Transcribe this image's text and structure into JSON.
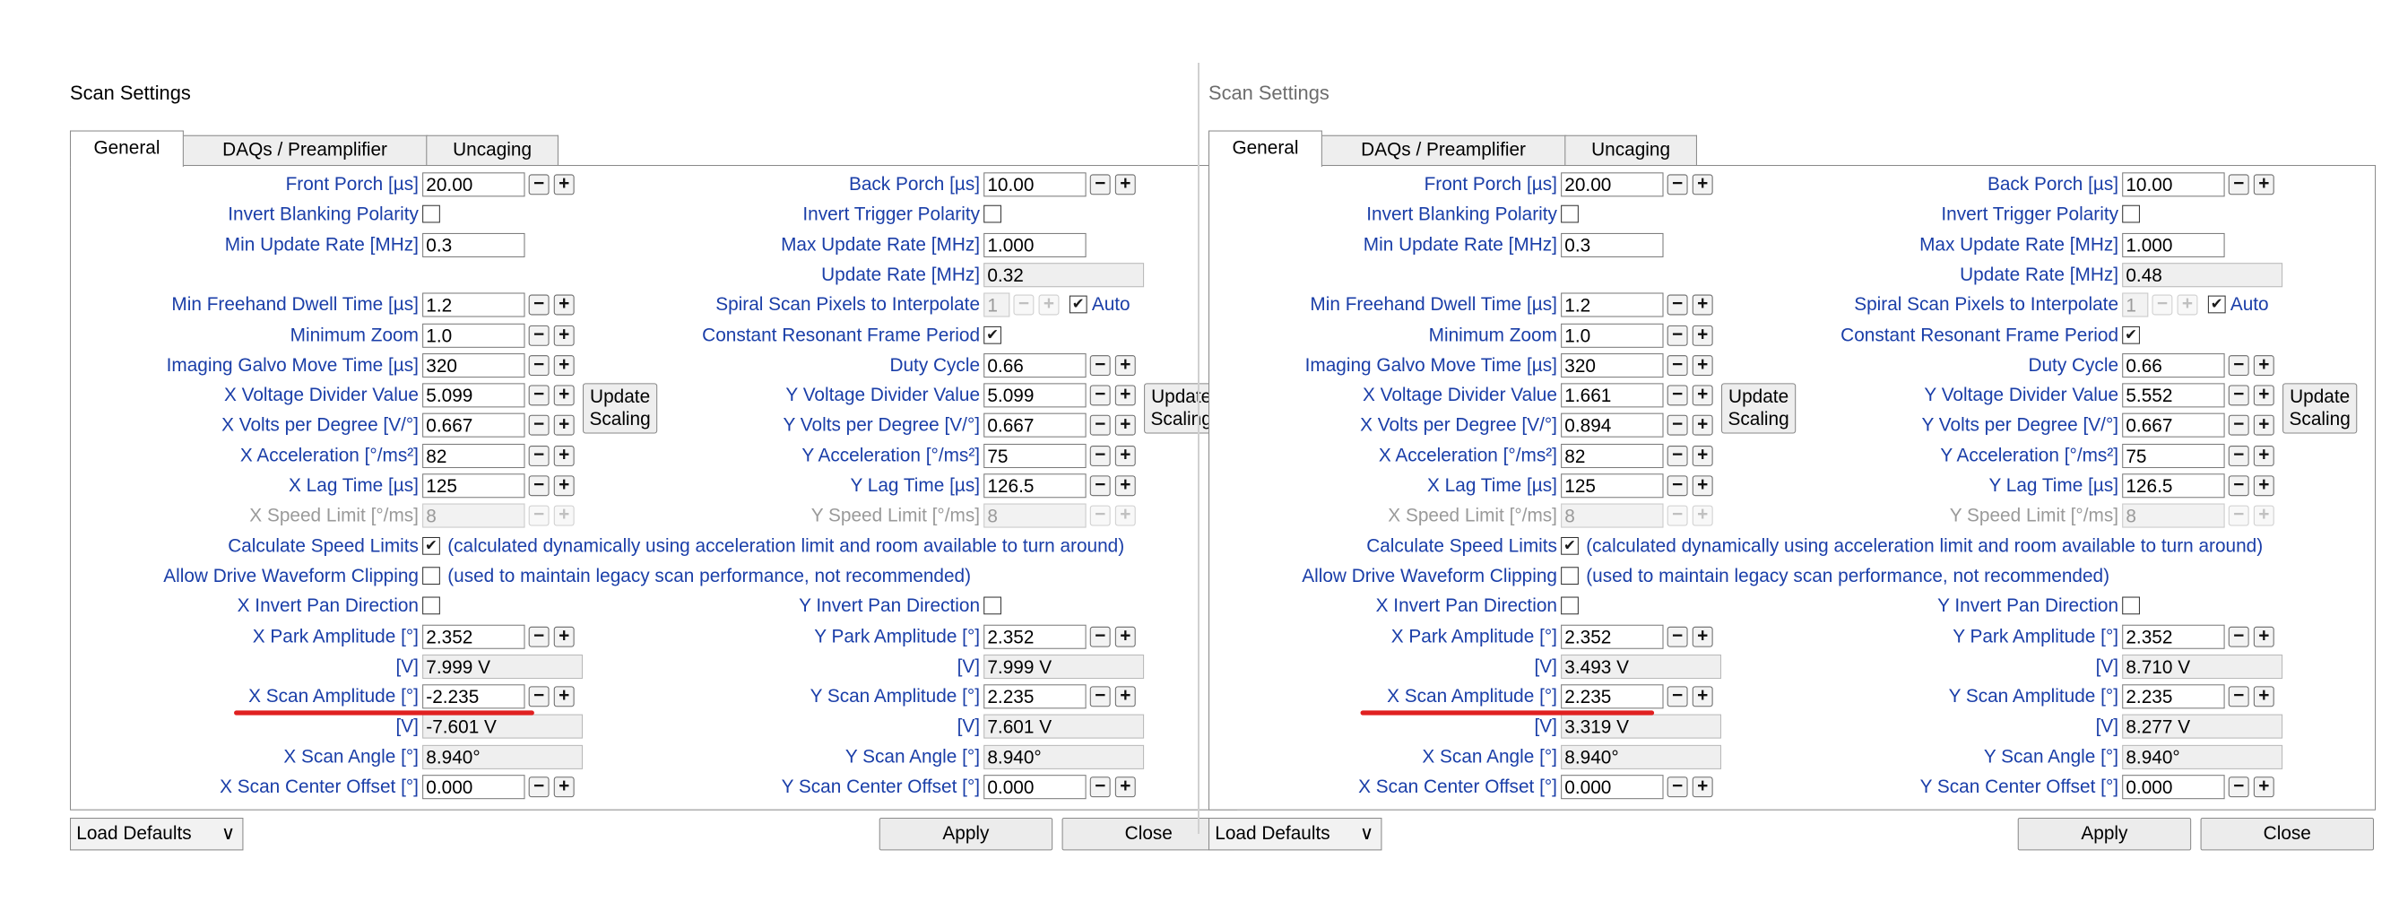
{
  "panels": [
    {
      "title": "Scan Settings",
      "title_dim": false,
      "tabs": [
        "General",
        "DAQs / Preamplifier",
        "Uncaging"
      ],
      "left": {
        "front_porch": {
          "label": "Front Porch [µs]",
          "value": "20.00"
        },
        "invert_blanking": {
          "label": "Invert Blanking Polarity"
        },
        "min_update": {
          "label": "Min Update Rate [MHz]",
          "value": "0.3"
        },
        "min_freehand": {
          "label": "Min Freehand Dwell Time [µs]",
          "value": "1.2"
        },
        "min_zoom": {
          "label": "Minimum Zoom",
          "value": "1.0"
        },
        "galvo_move": {
          "label": "Imaging Galvo Move Time [µs]",
          "value": "320"
        },
        "volt_div": {
          "label": "X Voltage Divider Value",
          "value": "5.099"
        },
        "volts_deg": {
          "label": "X Volts per Degree [V/°]",
          "value": "0.667"
        },
        "accel": {
          "label": "X Acceleration [°/ms²]",
          "value": "82"
        },
        "lag": {
          "label": "X Lag Time [µs]",
          "value": "125"
        },
        "speed": {
          "label": "X Speed Limit [°/ms]",
          "value": "8"
        },
        "invert_pan": {
          "label": "X Invert Pan Direction"
        },
        "park_amp": {
          "label": "X Park Amplitude [°]",
          "value": "2.352"
        },
        "park_v": {
          "label": "[V]",
          "value": "7.999 V"
        },
        "scan_amp": {
          "label": "X Scan Amplitude [°]",
          "value": "-2.235"
        },
        "scan_v": {
          "label": "[V]",
          "value": "-7.601 V"
        },
        "scan_angle": {
          "label": "X Scan Angle [°]",
          "value": "8.940°"
        },
        "center_off": {
          "label": "X Scan Center Offset [°]",
          "value": "0.000"
        }
      },
      "right": {
        "back_porch": {
          "label": "Back Porch [µs]",
          "value": "10.00"
        },
        "invert_trigger": {
          "label": "Invert Trigger Polarity"
        },
        "max_update": {
          "label": "Max Update Rate [MHz]",
          "value": "1.000"
        },
        "update_rate": {
          "label": "Update Rate [MHz]",
          "value": "0.32"
        },
        "spiral": {
          "label": "Spiral Scan Pixels to Interpolate",
          "value": "1",
          "auto": "Auto"
        },
        "const_res": {
          "label": "Constant Resonant Frame Period"
        },
        "duty": {
          "label": "Duty Cycle",
          "value": "0.66"
        },
        "volt_div": {
          "label": "Y Voltage Divider Value",
          "value": "5.099"
        },
        "volts_deg": {
          "label": "Y Volts per Degree [V/°]",
          "value": "0.667"
        },
        "accel": {
          "label": "Y Acceleration [°/ms²]",
          "value": "75"
        },
        "lag": {
          "label": "Y Lag Time [µs]",
          "value": "126.5"
        },
        "speed": {
          "label": "Y Speed Limit [°/ms]",
          "value": "8"
        },
        "invert_pan": {
          "label": "Y Invert Pan Direction"
        },
        "park_amp": {
          "label": "Y Park Amplitude [°]",
          "value": "2.352"
        },
        "park_v": {
          "label": "[V]",
          "value": "7.999 V"
        },
        "scan_amp": {
          "label": "Y Scan Amplitude [°]",
          "value": "2.235"
        },
        "scan_v": {
          "label": "[V]",
          "value": "7.601 V"
        },
        "scan_angle": {
          "label": "Y Scan Angle [°]",
          "value": "8.940°"
        },
        "center_off": {
          "label": "Y Scan Center Offset [°]",
          "value": "0.000"
        }
      },
      "update_scaling": "Update Scaling",
      "calc_speed": {
        "label": "Calculate Speed Limits",
        "note": "(calculated dynamically using acceleration limit and room available to turn around)"
      },
      "allow_clip": {
        "label": "Allow Drive Waveform Clipping",
        "note": "(used to maintain legacy scan performance, not recommended)"
      },
      "footer": {
        "load_defaults": "Load Defaults",
        "apply": "Apply",
        "close": "Close"
      }
    },
    {
      "title": "Scan Settings",
      "title_dim": true,
      "tabs": [
        "General",
        "DAQs / Preamplifier",
        "Uncaging"
      ],
      "left": {
        "front_porch": {
          "label": "Front Porch [µs]",
          "value": "20.00"
        },
        "invert_blanking": {
          "label": "Invert Blanking Polarity"
        },
        "min_update": {
          "label": "Min Update Rate [MHz]",
          "value": "0.3"
        },
        "min_freehand": {
          "label": "Min Freehand Dwell Time [µs]",
          "value": "1.2"
        },
        "min_zoom": {
          "label": "Minimum Zoom",
          "value": "1.0"
        },
        "galvo_move": {
          "label": "Imaging Galvo Move Time [µs]",
          "value": "320"
        },
        "volt_div": {
          "label": "X Voltage Divider Value",
          "value": "1.661"
        },
        "volts_deg": {
          "label": "X Volts per Degree [V/°]",
          "value": "0.894"
        },
        "accel": {
          "label": "X Acceleration [°/ms²]",
          "value": "82"
        },
        "lag": {
          "label": "X Lag Time [µs]",
          "value": "125"
        },
        "speed": {
          "label": "X Speed Limit [°/ms]",
          "value": "8"
        },
        "invert_pan": {
          "label": "X Invert Pan Direction"
        },
        "park_amp": {
          "label": "X Park Amplitude [°]",
          "value": "2.352"
        },
        "park_v": {
          "label": "[V]",
          "value": "3.493 V"
        },
        "scan_amp": {
          "label": "X Scan Amplitude [°]",
          "value": "2.235"
        },
        "scan_v": {
          "label": "[V]",
          "value": "3.319 V"
        },
        "scan_angle": {
          "label": "X Scan Angle [°]",
          "value": "8.940°"
        },
        "center_off": {
          "label": "X Scan Center Offset [°]",
          "value": "0.000"
        }
      },
      "right": {
        "back_porch": {
          "label": "Back Porch [µs]",
          "value": "10.00"
        },
        "invert_trigger": {
          "label": "Invert Trigger Polarity"
        },
        "max_update": {
          "label": "Max Update Rate [MHz]",
          "value": "1.000"
        },
        "update_rate": {
          "label": "Update Rate [MHz]",
          "value": "0.48"
        },
        "spiral": {
          "label": "Spiral Scan Pixels to Interpolate",
          "value": "1",
          "auto": "Auto"
        },
        "const_res": {
          "label": "Constant Resonant Frame Period"
        },
        "duty": {
          "label": "Duty Cycle",
          "value": "0.66"
        },
        "volt_div": {
          "label": "Y Voltage Divider Value",
          "value": "5.552"
        },
        "volts_deg": {
          "label": "Y Volts per Degree [V/°]",
          "value": "0.667"
        },
        "accel": {
          "label": "Y Acceleration [°/ms²]",
          "value": "75"
        },
        "lag": {
          "label": "Y Lag Time [µs]",
          "value": "126.5"
        },
        "speed": {
          "label": "Y Speed Limit [°/ms]",
          "value": "8"
        },
        "invert_pan": {
          "label": "Y Invert Pan Direction"
        },
        "park_amp": {
          "label": "Y Park Amplitude [°]",
          "value": "2.352"
        },
        "park_v": {
          "label": "[V]",
          "value": "8.710 V"
        },
        "scan_amp": {
          "label": "Y Scan Amplitude [°]",
          "value": "2.235"
        },
        "scan_v": {
          "label": "[V]",
          "value": "8.277 V"
        },
        "scan_angle": {
          "label": "Y Scan Angle [°]",
          "value": "8.940°"
        },
        "center_off": {
          "label": "Y Scan Center Offset [°]",
          "value": "0.000"
        }
      },
      "update_scaling": "Update Scaling",
      "calc_speed": {
        "label": "Calculate Speed Limits",
        "note": "(calculated dynamically using acceleration limit and room available to turn around)"
      },
      "allow_clip": {
        "label": "Allow Drive Waveform Clipping",
        "note": "(used to maintain legacy scan performance, not recommended)"
      },
      "footer": {
        "load_defaults": "Load Defaults",
        "apply": "Apply",
        "close": "Close"
      }
    }
  ],
  "colors": {
    "label_blue": "#1a3ea8",
    "highlight_red": "#e02020"
  }
}
